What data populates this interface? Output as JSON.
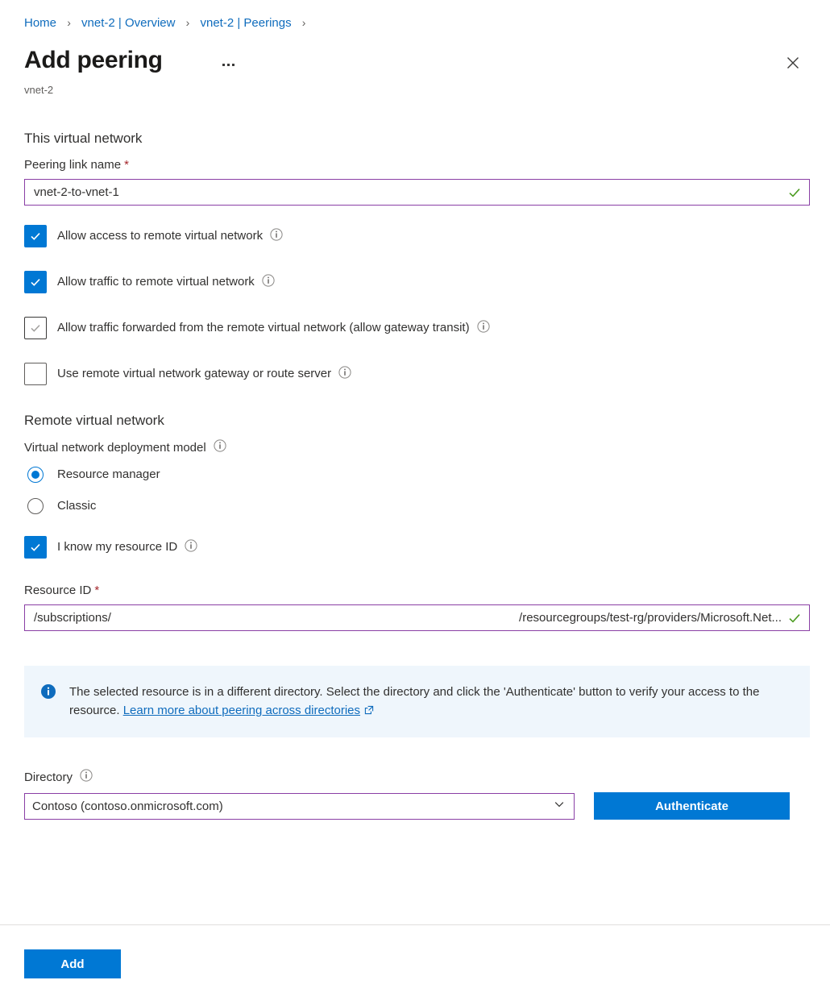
{
  "breadcrumb": {
    "items": [
      {
        "label": "Home"
      },
      {
        "label": "vnet-2 | Overview"
      },
      {
        "label": "vnet-2 | Peerings"
      }
    ],
    "separator": "›"
  },
  "header": {
    "title": "Add peering",
    "subtitle": "vnet-2",
    "ellipsis_name": "more-commands",
    "close_name": "close-icon"
  },
  "this_vnet": {
    "heading": "This virtual network",
    "peering_link_name": {
      "label": "Peering link name",
      "required_marker": "*",
      "value": "vnet-2-to-vnet-1",
      "placeholder": "Enter a name",
      "valid": true
    },
    "checkboxes": [
      {
        "label": "Allow access to remote virtual network",
        "state": "checked",
        "has_info": true
      },
      {
        "label": "Allow traffic to remote virtual network",
        "state": "checked",
        "has_info": true
      },
      {
        "label": "Allow traffic forwarded from the remote virtual network (allow gateway transit)",
        "state": "dim-checked",
        "has_info": true
      },
      {
        "label": "Use remote virtual network gateway or route server",
        "state": "unchecked",
        "has_info": true
      }
    ]
  },
  "remote_vnet": {
    "heading": "Remote virtual network",
    "deployment_model": {
      "label": "Virtual network deployment model",
      "has_info": true,
      "options": [
        {
          "label": "Resource manager",
          "selected": true
        },
        {
          "label": "Classic",
          "selected": false
        }
      ]
    },
    "know_resource_id": {
      "label": "I know my resource ID",
      "state": "checked",
      "has_info": true
    },
    "resource_id": {
      "label": "Resource ID",
      "required_marker": "*",
      "value_left": "/subscriptions/",
      "value_right": "/resourcegroups/test-rg/providers/Microsoft.Net...",
      "placeholder": "Enter the resource ID",
      "valid": true
    }
  },
  "banner": {
    "icon": "info-icon",
    "text": "The selected resource is in a different directory. Select the directory and click the 'Authenticate' button to verify your access to the resource.",
    "link_text": "Learn more about peering across directories",
    "background": "#eff6fc",
    "icon_color": "#0f6cbd"
  },
  "directory": {
    "label": "Directory",
    "has_info": true,
    "selected": "Contoso (contoso.onmicrosoft.com)",
    "authenticate_label": "Authenticate"
  },
  "footer": {
    "add_label": "Add"
  },
  "colors": {
    "accent": "#0078d4",
    "link": "#0f6cbd",
    "required": "#a4262c",
    "valid_border": "#8a3fa5",
    "valid_check": "#4a9b1f"
  }
}
